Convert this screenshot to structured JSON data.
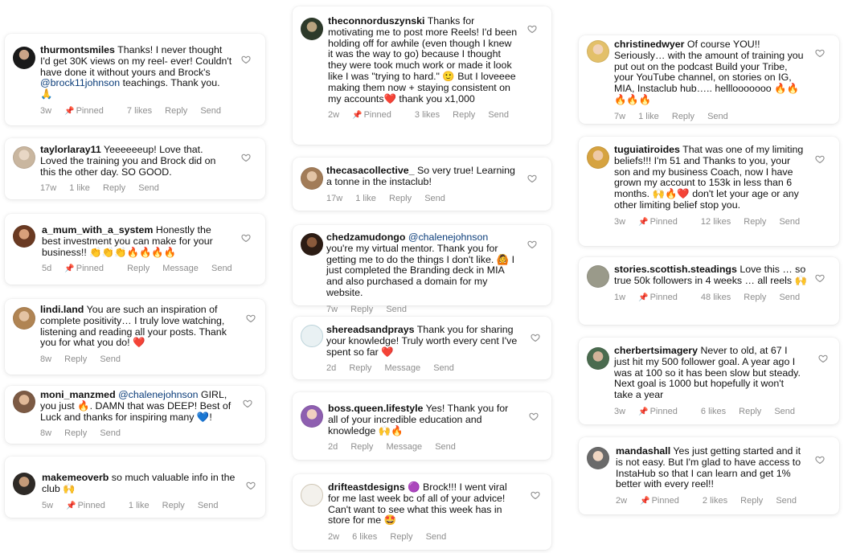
{
  "colors": {
    "muted": "#8e8e8e",
    "mention": "#0b3d7a",
    "card_bg": "#ffffff"
  },
  "icons": {
    "like": "heart-outline-icon",
    "pin": "pin-icon"
  },
  "comments": [
    {
      "username": "thurmontsmiles",
      "parts": [
        {
          "t": " Thanks! I never thought I'd get 30K views on my reel- ever! Couldn't have done it without yours and Brock's "
        },
        {
          "t": "@brock11johnson",
          "m": true
        },
        {
          "t": " teachings. Thank you. 🙏"
        }
      ],
      "time": "3w",
      "pinned": "Pinned",
      "likes": "7 likes",
      "reply": "Reply",
      "action": "Send"
    },
    {
      "username": "taylorlaray11",
      "parts": [
        {
          "t": " Yeeeeeeup! Love that. Loved the training you and Brock did on this the other day. SO GOOD."
        }
      ],
      "time": "17w",
      "likes": "1 like",
      "reply": "Reply",
      "action": "Send"
    },
    {
      "username": "a_mum_with_a_system",
      "parts": [
        {
          "t": " Honestly the best investment you can make for your business!! 👏👏👏🔥🔥🔥🔥"
        }
      ],
      "time": "5d",
      "pinned": "Pinned",
      "reply": "Reply",
      "action": "Message",
      "action2": "Send"
    },
    {
      "username": "lindi.land",
      "parts": [
        {
          "t": " You are such an inspiration of complete positivity… I truly love watching, listening and reading all your posts. Thank you for what you do! ❤️"
        }
      ],
      "time": "8w",
      "reply": "Reply",
      "action": "Send"
    },
    {
      "username": "moni_manzmed",
      "parts": [
        {
          "t": " "
        },
        {
          "t": "@chalenejohnson",
          "m": true
        },
        {
          "t": " GIRL, you just 🔥. DAMN that was DEEP! Best of Luck and thanks for inspiring many 💙!"
        }
      ],
      "time": "8w",
      "reply": "Reply",
      "action": "Send"
    },
    {
      "username": "makemeoverb",
      "parts": [
        {
          "t": " so much valuable info in the club 🙌"
        }
      ],
      "time": "5w",
      "pinned": "Pinned",
      "likes": "1 like",
      "reply": "Reply",
      "action": "Send"
    },
    {
      "username": "theconnorduszynski",
      "parts": [
        {
          "t": " Thanks for motivating me to post more Reels! I'd been holding off for awhile (even though I knew it was the way to go) because I thought they were took much work or made it look like I was \"trying to hard.\" 🙂 But I loveeee making them now + staying consistent on my accounts❤️ thank you x1,000"
        }
      ],
      "time": "2w",
      "pinned": "Pinned",
      "likes": "3 likes",
      "reply": "Reply",
      "action": "Send"
    },
    {
      "username": "thecasacollective_",
      "parts": [
        {
          "t": " So very true! Learning a tonne in the instaclub!"
        }
      ],
      "time": "17w",
      "likes": "1 like",
      "reply": "Reply",
      "action": "Send"
    },
    {
      "username": "chedzamudongo",
      "parts": [
        {
          "t": " "
        },
        {
          "t": "@chalenejohnson",
          "m": true
        },
        {
          "t": " you're my virtual mentor. Thank you for getting me to do the things I don't like. 🙆 I just completed the Branding deck in MIA and also purchased a domain for my website."
        }
      ],
      "time": "7w",
      "reply": "Reply",
      "action": "Send"
    },
    {
      "username": "shereadsandprays",
      "parts": [
        {
          "t": " Thank you for sharing your knowledge! Truly worth every cent I've spent so far ❤️"
        }
      ],
      "time": "2d",
      "reply": "Reply",
      "action": "Message",
      "action2": "Send"
    },
    {
      "username": "boss.queen.lifestyle",
      "parts": [
        {
          "t": " Yes!  Thank you for all of your incredible education and knowledge 🙌🔥"
        }
      ],
      "time": "2d",
      "reply": "Reply",
      "action": "Message",
      "action2": "Send"
    },
    {
      "username": "drifteastdesigns",
      "parts": [
        {
          "t": " 🟣 Brock!!! I went viral for me last week bc of all of your advice! Can't want to see what this week has in store for me 🤩"
        }
      ],
      "time": "2w",
      "likes": "6 likes",
      "reply": "Reply",
      "action": "Send"
    },
    {
      "username": "christinedwyer",
      "parts": [
        {
          "t": " Of course YOU!! Seriously… with the amount of training you put out on the podcast Build your Tribe, your YouTube channel, on stories on IG, MIA, Instaclub hub….. helllooooooo 🔥🔥 🔥🔥🔥"
        }
      ],
      "time": "7w",
      "likes": "1 like",
      "reply": "Reply",
      "action": "Send"
    },
    {
      "username": "tuguiatiroides",
      "parts": [
        {
          "t": " That was one of my limiting beliefs!!! I'm 51 and Thanks to you, your son and my business Coach, now I have grown my account to 153k in less than 6 months. 🙌🔥❤️ don't let your age or any other limiting belief stop you."
        }
      ],
      "time": "3w",
      "pinned": "Pinned",
      "likes": "12 likes",
      "reply": "Reply",
      "action": "Send"
    },
    {
      "username": "stories.scottish.steadings",
      "parts": [
        {
          "t": " Love this … so true 50k followers in 4 weeks … all reels 🙌"
        }
      ],
      "time": "1w",
      "pinned": "Pinned",
      "likes": "48 likes",
      "reply": "Reply",
      "action": "Send"
    },
    {
      "username": "cherbertsimagery",
      "parts": [
        {
          "t": " Never to old, at 67 I just hit my 500 follower goal.  A year ago I was at 100 so it has been slow but steady.  Next goal is 1000 but hopefully it won't take a year"
        }
      ],
      "time": "3w",
      "pinned": "Pinned",
      "likes": "6 likes",
      "reply": "Reply",
      "action": "Send"
    },
    {
      "username": "mandashall",
      "parts": [
        {
          "t": " Yes just getting started and it is not easy. But I'm glad to have access to InstaHub so that I can learn and get 1% better with every reel!!"
        }
      ],
      "time": "2w",
      "pinned": "Pinned",
      "likes": "2 likes",
      "reply": "Reply",
      "action": "Send"
    }
  ]
}
